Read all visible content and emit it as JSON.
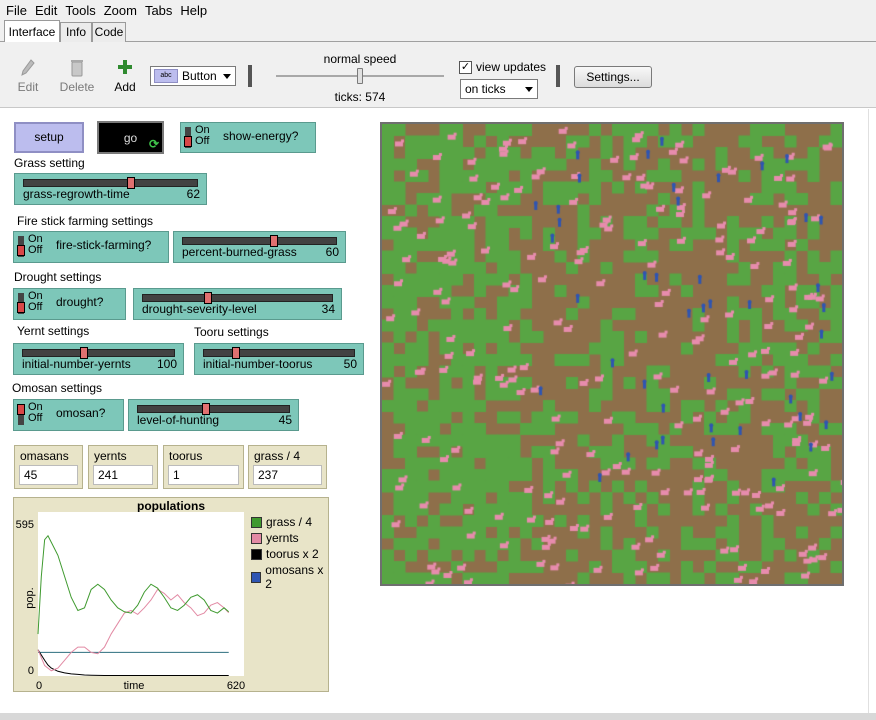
{
  "menu": [
    "File",
    "Edit",
    "Tools",
    "Zoom",
    "Tabs",
    "Help"
  ],
  "tabs": [
    {
      "label": "Interface",
      "active": true
    },
    {
      "label": "Info",
      "active": false
    },
    {
      "label": "Code",
      "active": false
    }
  ],
  "toolbar": {
    "edit_label": "Edit",
    "delete_label": "Delete",
    "add_label": "Add",
    "widget_type": "Button",
    "speed_label": "normal speed",
    "speed_value": 0.5,
    "ticks_label": "ticks: 574",
    "view_updates_label": "view updates",
    "view_updates_checked": true,
    "update_mode": "on ticks",
    "settings_label": "Settings..."
  },
  "buttons": {
    "setup": "setup",
    "go": "go"
  },
  "switches": {
    "show_energy": {
      "label": "show-energy?",
      "on": "On",
      "off": "Off"
    },
    "fire_stick": {
      "label": "fire-stick-farming?",
      "on": "On",
      "off": "Off"
    },
    "drought": {
      "label": "drought?",
      "on": "On",
      "off": "Off"
    },
    "omosan": {
      "label": "omosan?",
      "on": "On",
      "off": "Off"
    }
  },
  "sections": {
    "grass": "Grass setting",
    "fire": "Fire stick farming settings",
    "drought": "Drought settings",
    "yernt": "Yernt settings",
    "tooru": "Tooru settings",
    "omosan": "Omosan settings"
  },
  "sliders": {
    "grass_regrowth_time": {
      "name": "grass-regrowth-time",
      "value": "62",
      "fraction": 0.62
    },
    "percent_burned_grass": {
      "name": "percent-burned-grass",
      "value": "60",
      "fraction": 0.6
    },
    "drought_severity_level": {
      "name": "drought-severity-level",
      "value": "34",
      "fraction": 0.34
    },
    "initial_number_yernts": {
      "name": "initial-number-yernts",
      "value": "100",
      "fraction": 0.4
    },
    "initial_number_toorus": {
      "name": "initial-number-toorus",
      "value": "50",
      "fraction": 0.2
    },
    "level_of_hunting": {
      "name": "level-of-hunting",
      "value": "45",
      "fraction": 0.45
    }
  },
  "monitors": [
    {
      "label": "omasans",
      "value": "45"
    },
    {
      "label": "yernts",
      "value": "241"
    },
    {
      "label": "toorus",
      "value": "1"
    },
    {
      "label": "grass / 4",
      "value": "237"
    }
  ],
  "chart_data": {
    "type": "line",
    "title": "populations",
    "xlabel": "time",
    "ylabel": "pop.",
    "xlim": [
      0,
      620
    ],
    "ylim": [
      0,
      595
    ],
    "x_ticks": [
      "0",
      "620"
    ],
    "y_ticks": [
      "0",
      "595"
    ],
    "legend_position": "right",
    "series": [
      {
        "name": "grass / 4",
        "color": "#3f9a2f",
        "x": [
          0,
          10,
          20,
          30,
          40,
          60,
          80,
          100,
          120,
          140,
          160,
          180,
          200,
          220,
          240,
          260,
          280,
          300,
          320,
          340,
          360,
          380,
          400,
          420,
          440,
          460,
          480,
          500,
          520,
          540,
          560,
          574
        ],
        "y": [
          160,
          380,
          520,
          535,
          510,
          460,
          380,
          300,
          250,
          260,
          330,
          350,
          330,
          290,
          260,
          245,
          240,
          270,
          320,
          350,
          335,
          300,
          260,
          250,
          270,
          300,
          310,
          290,
          250,
          240,
          260,
          245
        ]
      },
      {
        "name": "yernts",
        "color": "#e28aa4",
        "x": [
          0,
          20,
          40,
          60,
          80,
          100,
          120,
          140,
          160,
          180,
          200,
          220,
          240,
          260,
          280,
          300,
          320,
          340,
          360,
          380,
          400,
          420,
          440,
          460,
          480,
          500,
          520,
          540,
          560,
          574
        ],
        "y": [
          100,
          40,
          20,
          30,
          60,
          90,
          110,
          110,
          90,
          85,
          110,
          160,
          200,
          240,
          250,
          235,
          260,
          290,
          330,
          315,
          290,
          310,
          280,
          260,
          230,
          240,
          270,
          280,
          260,
          241
        ]
      },
      {
        "name": "toorus x 2",
        "color": "#000000",
        "x": [
          0,
          10,
          20,
          30,
          40,
          60,
          80,
          100,
          120,
          140,
          160,
          200,
          300,
          400,
          500,
          574
        ],
        "y": [
          100,
          80,
          60,
          42,
          30,
          18,
          12,
          8,
          6,
          4,
          3,
          2,
          2,
          2,
          2,
          2
        ]
      },
      {
        "name": "omosans x 2",
        "color": "#2c6e7e",
        "x": [
          0,
          574
        ],
        "y": [
          90,
          90
        ]
      }
    ]
  },
  "world": {
    "grass_color": "#58a544",
    "dirt_color": "#8e6f4a",
    "yernt_color": "#e78cad",
    "omosan_color": "#2f55b2",
    "rows": 40,
    "cols": 40,
    "seed": 57,
    "green_fraction": 0.45,
    "yernt_count": 241,
    "omosan_count": 45
  }
}
